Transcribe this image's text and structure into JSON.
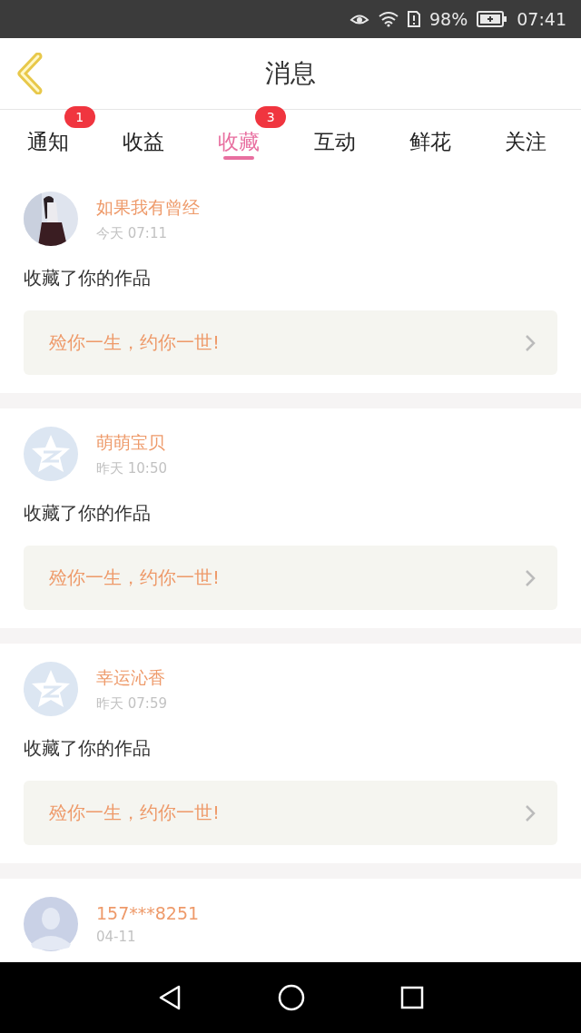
{
  "status_bar": {
    "battery": "98%",
    "time": "07:41"
  },
  "header": {
    "title": "消息"
  },
  "tabs": [
    {
      "label": "通知",
      "selected": false,
      "badge": "1"
    },
    {
      "label": "收益",
      "selected": false
    },
    {
      "label": "收藏",
      "selected": true,
      "badge": "3"
    },
    {
      "label": "互动",
      "selected": false
    },
    {
      "label": "鲜花",
      "selected": false
    },
    {
      "label": "关注",
      "selected": false
    }
  ],
  "messages": [
    {
      "name": "如果我有曾经",
      "time": "今天  07:11",
      "action": "收藏了你的作品",
      "work": "殓你一生，约你一世!"
    },
    {
      "avatar": {
        "kind": "star"
      },
      "name": "萌萌宝贝",
      "time": "昨天  10:50",
      "action": "收藏了你的作品",
      "work": "殓你一生，约你一世!"
    },
    {
      "avatar": {
        "kind": "star"
      },
      "name": "幸运沁香",
      "time": "昨天  07:59",
      "action": "收藏了你的作品",
      "work": "殓你一生，约你一世!"
    },
    {
      "avatar": {
        "kind": "person"
      },
      "name": "157***8251",
      "time": "04-11"
    }
  ]
}
